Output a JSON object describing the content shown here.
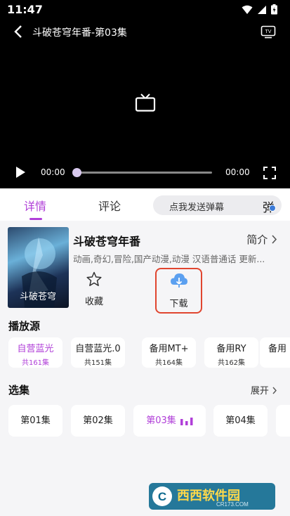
{
  "status": {
    "time": "11:47"
  },
  "player": {
    "title": "斗破苍穹年番-第03集",
    "current_time": "00:00",
    "total_time": "00:00",
    "progress": 0
  },
  "tabs": [
    {
      "label": "详情",
      "active": true
    },
    {
      "label": "评论",
      "active": false
    }
  ],
  "danmaku": {
    "placeholder": "点我发送弹幕",
    "button_label": "弹"
  },
  "show": {
    "title": "斗破苍穹年番",
    "intro_label": "简介",
    "tags": "动画,奇幻,冒险,国产动漫,动漫 汉语普通话 更新...",
    "poster_text": "斗破苍穹"
  },
  "actions": {
    "favorite_label": "收藏",
    "download_label": "下载"
  },
  "sources": {
    "title": "播放源",
    "items": [
      {
        "name": "自营蓝光",
        "count": "共161集",
        "active": true
      },
      {
        "name": "自营蓝光.0",
        "count": "共151集",
        "active": false
      },
      {
        "name": "备用MT+",
        "count": "共164集",
        "active": false
      },
      {
        "name": "备用RY",
        "count": "共162集",
        "active": false
      },
      {
        "name": "备用",
        "count": "",
        "active": false
      }
    ]
  },
  "episodes": {
    "title": "选集",
    "expand_label": "展开",
    "items": [
      {
        "label": "第01集",
        "active": false
      },
      {
        "label": "第02集",
        "active": false
      },
      {
        "label": "第03集",
        "active": true
      },
      {
        "label": "第04集",
        "active": false
      }
    ]
  },
  "watermark": {
    "text": "西西软件园",
    "sub": "CR173.COM"
  },
  "colors": {
    "accent": "#b03fd8",
    "download_icon": "#5ba0f0",
    "highlight_border": "#e0452f"
  }
}
